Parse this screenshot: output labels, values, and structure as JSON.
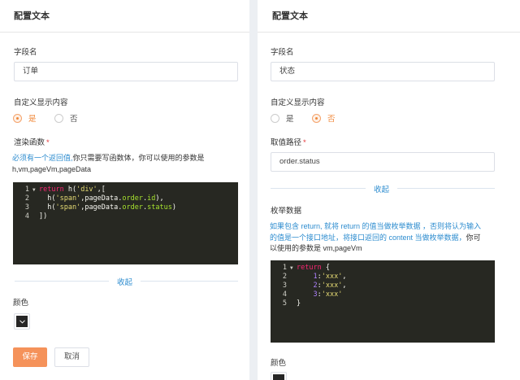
{
  "left": {
    "title": "配置文本",
    "field_name_label": "字段名",
    "field_name_value": "订单",
    "custom_display_label": "自定义显示内容",
    "radio_yes": "是",
    "radio_no": "否",
    "render_label": "渲染函数",
    "required_mark": "*",
    "desc_highlight": "必须有一个返回值,",
    "desc_rest": "你只需要写函数体，你可以使用的参数是",
    "desc_params": "h,vm,pageVm,pageData",
    "code_lines": [
      {
        "n": "1",
        "fold": true,
        "segs": [
          [
            "kw",
            "return"
          ],
          [
            "txt",
            " h("
          ],
          [
            "str",
            "'div'"
          ],
          [
            "txt",
            ",["
          ]
        ]
      },
      {
        "n": "2",
        "fold": false,
        "segs": [
          [
            "txt",
            "  h("
          ],
          [
            "str",
            "'span'"
          ],
          [
            "txt",
            ",pageData."
          ],
          [
            "prop",
            "order"
          ],
          [
            "txt",
            "."
          ],
          [
            "prop",
            "id"
          ],
          [
            "txt",
            "),"
          ]
        ]
      },
      {
        "n": "3",
        "fold": false,
        "segs": [
          [
            "txt",
            "  h("
          ],
          [
            "str",
            "'span'"
          ],
          [
            "txt",
            ",pageData."
          ],
          [
            "prop",
            "order"
          ],
          [
            "txt",
            "."
          ],
          [
            "prop",
            "status"
          ],
          [
            "txt",
            ")"
          ]
        ]
      },
      {
        "n": "4",
        "fold": false,
        "segs": [
          [
            "txt",
            "])"
          ]
        ]
      }
    ],
    "collapse_label": "收起",
    "color_label": "颜色",
    "save_label": "保存",
    "cancel_label": "取消"
  },
  "right": {
    "title": "配置文本",
    "field_name_label": "字段名",
    "field_name_value": "状态",
    "custom_display_label": "自定义显示内容",
    "radio_yes": "是",
    "radio_no": "否",
    "path_label": "取值路径",
    "required_mark": "*",
    "path_value": "order.status",
    "collapse_label": "收起",
    "enum_label": "枚举数据",
    "enum_desc_1": "如果包含 return, 就将 return 的值当做枚举数据 ，否则将认为输入",
    "enum_desc_2": "的值是一个接口地址，将接口返回的 content 当做枚举数据，",
    "enum_desc_2b": "你可",
    "enum_desc_3": "以使用的参数是 vm,pageVm",
    "code_lines": [
      {
        "n": "1",
        "fold": true,
        "segs": [
          [
            "kw",
            "return"
          ],
          [
            "txt",
            " {"
          ]
        ]
      },
      {
        "n": "2",
        "fold": false,
        "segs": [
          [
            "txt",
            "    "
          ],
          [
            "num",
            "1"
          ],
          [
            "txt",
            ":"
          ],
          [
            "str",
            "'xxx'"
          ],
          [
            "txt",
            ","
          ]
        ]
      },
      {
        "n": "3",
        "fold": false,
        "segs": [
          [
            "txt",
            "    "
          ],
          [
            "num",
            "2"
          ],
          [
            "txt",
            ":"
          ],
          [
            "str",
            "'xxx'"
          ],
          [
            "txt",
            ","
          ]
        ]
      },
      {
        "n": "4",
        "fold": false,
        "segs": [
          [
            "txt",
            "    "
          ],
          [
            "num",
            "3"
          ],
          [
            "txt",
            ":"
          ],
          [
            "str",
            "'xxx'"
          ]
        ]
      },
      {
        "n": "5",
        "fold": false,
        "segs": [
          [
            "txt",
            "}"
          ]
        ]
      }
    ],
    "color_label": "颜色"
  },
  "colors": {
    "accent": "#f5925a",
    "link": "#2d8ccf",
    "code_bg": "#272822"
  }
}
